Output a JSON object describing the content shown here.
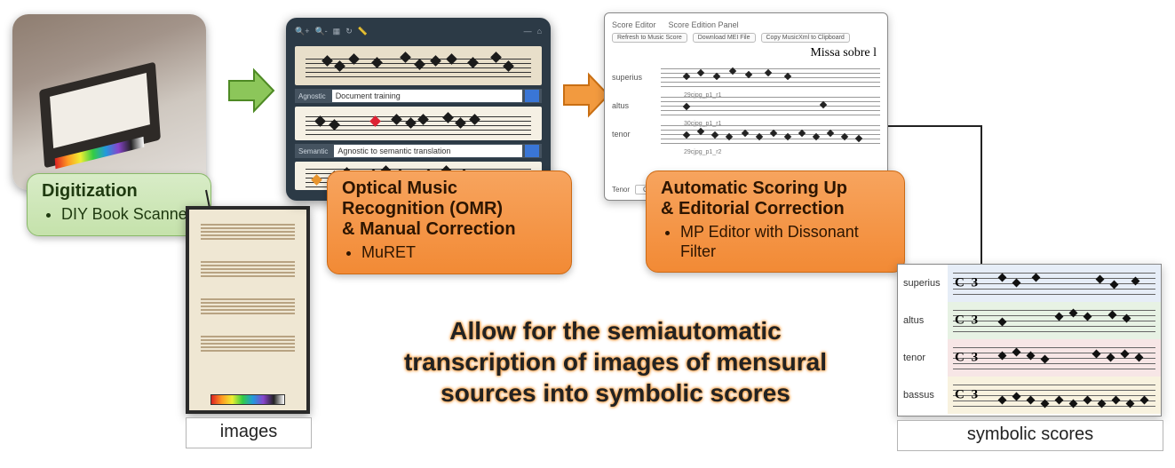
{
  "digitization": {
    "title": "Digitization",
    "bullet": "DIY Book Scanner"
  },
  "omr": {
    "title_line1": "Optical Music",
    "title_line2": "Recognition (OMR)",
    "title_line3": "& Manual Correction",
    "bullet": "MuRET",
    "toolbar_icons": [
      "magnify-plus",
      "magnify-minus",
      "layers",
      "rotate",
      "ruler",
      "divider",
      "minus",
      "home"
    ],
    "dropdown1_label": "Agnostic",
    "dropdown1_value": "Document training",
    "dropdown2_label": "Semantic",
    "dropdown2_value": "Agnostic to semantic translation"
  },
  "scoreup": {
    "title_line1": "Automatic Scoring Up",
    "title_line2": "& Editorial Correction",
    "bullet": "MP Editor with Dissonant Filter",
    "tabs": [
      "Score Editor",
      "Score Edition Panel"
    ],
    "buttons": [
      "Refresh to Music Score",
      "Download MEI File",
      "Copy MusicXml to Clipboard"
    ],
    "piece_title": "Missa sobre l",
    "voices": [
      {
        "name": "superius",
        "caption": "29cjpg_p1_r1"
      },
      {
        "name": "altus",
        "caption": "30cjpg_p1_r1"
      },
      {
        "name": "tenor",
        "caption": "29cjpg_p1_r2"
      }
    ],
    "bottom_label": "Tenor",
    "bottom_dropdown": "General"
  },
  "images_caption": "images",
  "symbolic": {
    "caption": "symbolic scores",
    "time_sig": "C 3",
    "voices": [
      "superius",
      "altus",
      "tenor",
      "bassus"
    ]
  },
  "center_text": {
    "line1": "Allow for the semiautomatic",
    "line2": "transcription of images of mensural",
    "line3": "sources into symbolic scores"
  },
  "arrow_colors": {
    "green": "#76b43f",
    "orange": "#ec8a2e"
  }
}
